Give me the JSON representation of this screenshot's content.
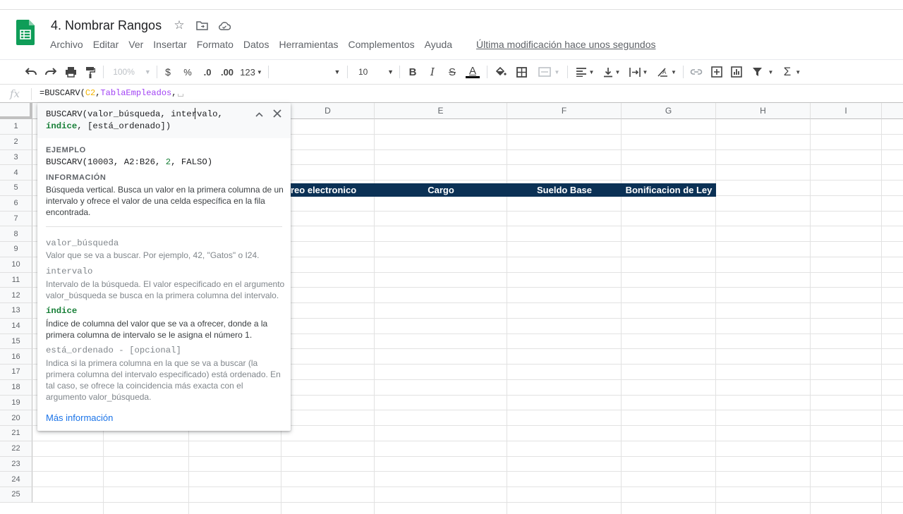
{
  "app": {
    "doc_title": "4. Nombrar Rangos",
    "last_modified": "Última modificación hace unos segundos",
    "brand_color": "#0f9d58"
  },
  "menu": [
    "Archivo",
    "Editar",
    "Ver",
    "Insertar",
    "Formato",
    "Datos",
    "Herramientas",
    "Complementos",
    "Ayuda"
  ],
  "toolbar": {
    "zoom": "100%",
    "currency": "$",
    "percent": "%",
    "decrease_decimals": ".0",
    "increase_decimals": ".00",
    "more_formats": "123",
    "font_size": "10",
    "bold": "B",
    "italic": "I",
    "strike": "S",
    "text_color": "A",
    "sum": "Σ"
  },
  "formula_bar": {
    "fx": "fx",
    "prefix": "=BUSCARV(",
    "arg1": "C2",
    "comma1": ",",
    "arg2": "TablaEmpleados",
    "comma2": ","
  },
  "columns": [
    "D",
    "E",
    "F",
    "G",
    "H",
    "I"
  ],
  "rows": [
    "1",
    "2",
    "3",
    "4",
    "5",
    "6",
    "7",
    "8",
    "9",
    "10",
    "11",
    "12",
    "13",
    "14",
    "15",
    "16",
    "17",
    "18",
    "19",
    "20",
    "21",
    "22",
    "23",
    "24",
    "25"
  ],
  "table_headers": [
    "orreo electronico",
    "Cargo",
    "Sueldo Base",
    "Bonificacion de Ley"
  ],
  "header_fill": "#0b3155",
  "help": {
    "sig_line1": "BUSCARV(valor_búsqueda, intervalo,",
    "sig_active": "índice",
    "sig_line2_rest": ", [está_ordenado])",
    "example_label": "EJEMPLO",
    "example_pre": "BUSCARV(10003, A2:B26, ",
    "example_num": "2",
    "example_post": ", FALSO)",
    "info_label": "INFORMACIÓN",
    "info_text": "Búsqueda vertical. Busca un valor en la primera columna de un intervalo y ofrece el valor de una celda específica en la fila encontrada.",
    "args": [
      {
        "name": "valor_búsqueda",
        "desc": "Valor que se va a buscar. Por ejemplo, 42, \"Gatos\" o I24."
      },
      {
        "name": "intervalo",
        "desc": "Intervalo de la búsqueda. El valor especificado en el argumento valor_búsqueda se busca en la primera columna del intervalo."
      },
      {
        "name": "índice",
        "desc": "Índice de columna del valor que se va a ofrecer, donde a la primera columna de intervalo se le asigna el número 1."
      },
      {
        "name": "está_ordenado - [opcional]",
        "desc": "Indica si la primera columna en la que se va a buscar (la primera columna del intervalo especificado) está ordenado. En tal caso, se ofrece la coincidencia más exacta con el argumento valor_búsqueda."
      }
    ],
    "more_link": "Más información",
    "active_color": "#188038"
  }
}
